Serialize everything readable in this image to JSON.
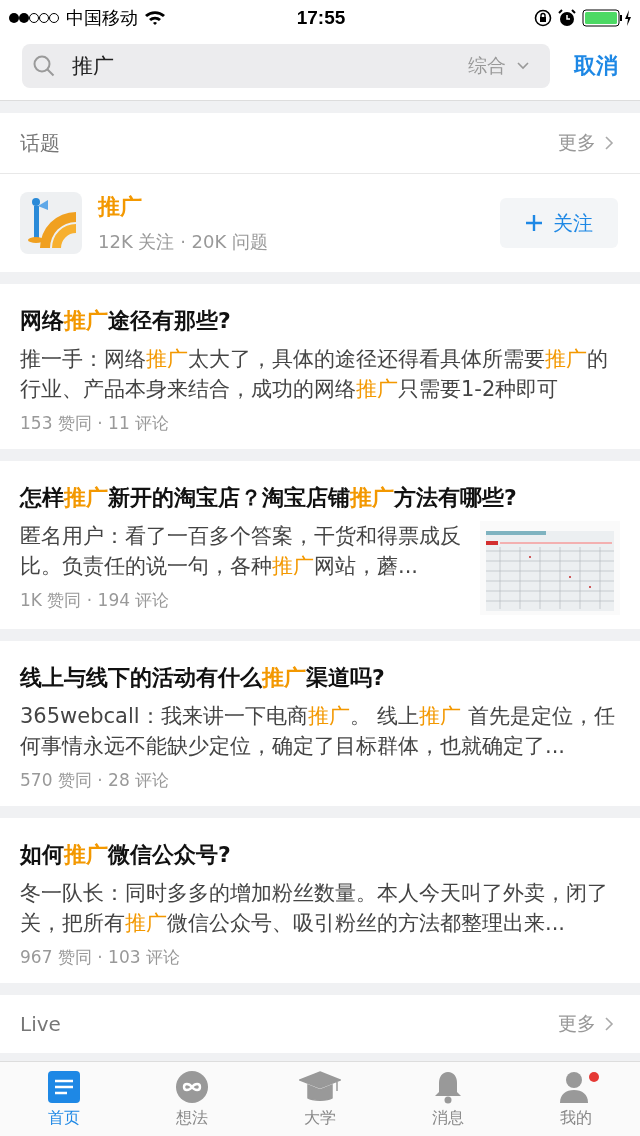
{
  "status_bar": {
    "carrier": "中国移动",
    "time": "17:55"
  },
  "search": {
    "value": "推广",
    "scope": "综合",
    "cancel": "取消"
  },
  "topics": {
    "title": "话题",
    "more": "更多",
    "items": [
      {
        "name": "推广",
        "stats": "12K 关注 · 20K 问题",
        "follow": "关注"
      }
    ]
  },
  "questions": [
    {
      "title": "网络**推广**途径有那些?",
      "excerpt": "推一手：网络**推广**太大了，具体的途径还得看具体所需要**推广**的行业、产品本身来结合，成功的网络**推广**只需要1-2种即可",
      "meta": "153 赞同 · 11 评论"
    },
    {
      "title": "怎样**推广**新开的淘宝店？淘宝店铺**推广**方法有哪些?",
      "excerpt": "匿名用户：看了一百多个答案，干货和得票成反比。负责任的说一句，各种**推广**网站，蘑...",
      "meta": "1K 赞同 · 194 评论"
    },
    {
      "title": "线上与线下的活动有什么**推广**渠道吗?",
      "excerpt": "365webcall：我来讲一下电商**推广**。 线上**推广** 首先是定位，任何事情永远不能缺少定位，确定了目标群体，也就确定了...",
      "meta": "570 赞同 · 28 评论"
    },
    {
      "title": "如何**推广**微信公众号?",
      "excerpt": "冬一队长：同时多多的增加粉丝数量。本人今天叫了外卖，闭了关，把所有**推广**微信公众号、吸引粉丝的方法都整理出来...",
      "meta": "967 赞同 · 103 评论"
    }
  ],
  "live": {
    "title": "Live",
    "more": "更多"
  },
  "tabs": [
    {
      "label": "首页",
      "selected": true,
      "kind": "home",
      "dot": false
    },
    {
      "label": "想法",
      "selected": false,
      "kind": "idea",
      "dot": false
    },
    {
      "label": "大学",
      "selected": false,
      "kind": "university",
      "dot": false
    },
    {
      "label": "消息",
      "selected": false,
      "kind": "bell",
      "dot": false
    },
    {
      "label": "我的",
      "selected": false,
      "kind": "person",
      "dot": true
    }
  ]
}
